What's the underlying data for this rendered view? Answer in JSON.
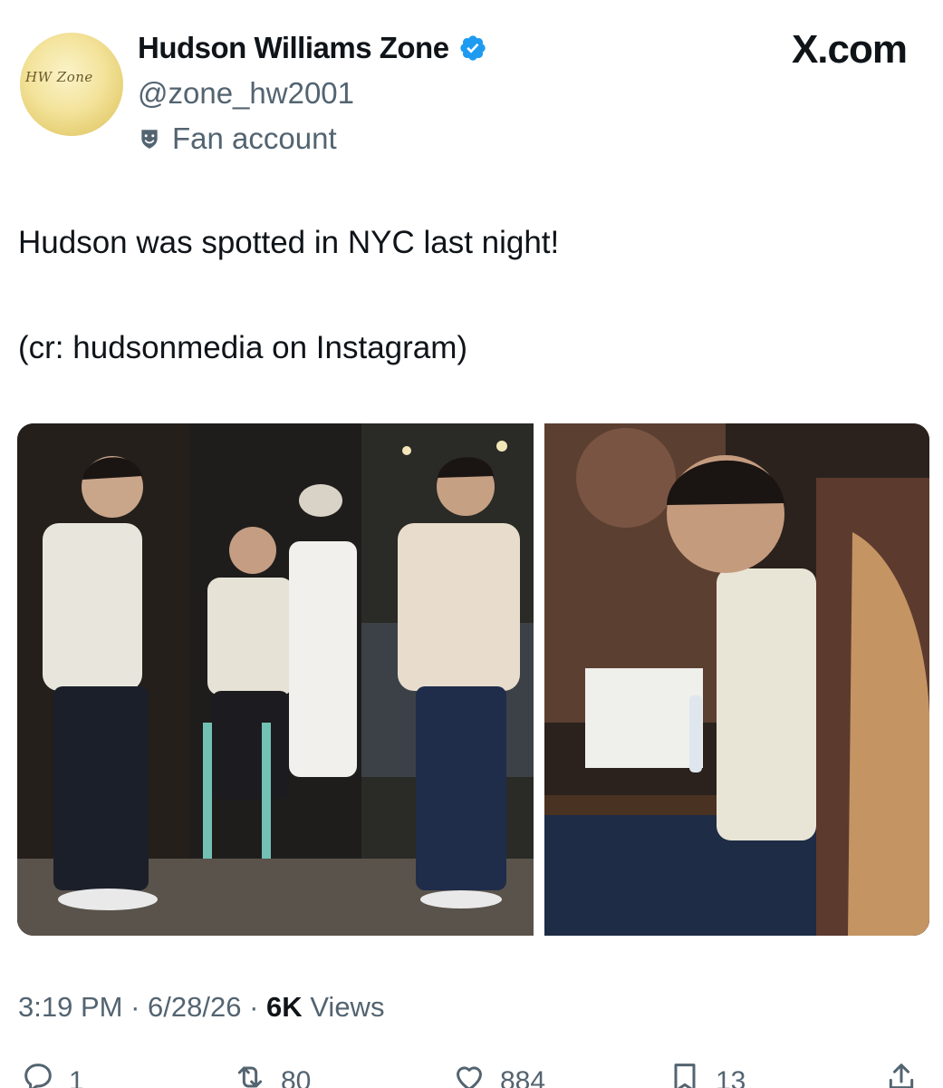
{
  "header": {
    "avatar_text": "HW Zone",
    "display_name": "Hudson Williams Zone",
    "handle": "@zone_hw2001",
    "account_label": "Fan account",
    "site": "X.com"
  },
  "tweet": {
    "line1": "Hudson was spotted in NYC last night!",
    "line2": "(cr: hudsonmedia on Instagram)"
  },
  "meta": {
    "time": "3:19 PM",
    "sep1": "·",
    "date": "6/28/26",
    "sep2": "·",
    "views_count": "6K",
    "views_label": "Views"
  },
  "actions": {
    "replies": "1",
    "reposts": "80",
    "likes": "884",
    "bookmarks": "13"
  },
  "colors": {
    "verified_blue": "#1d9bf0",
    "secondary_text": "#536471",
    "primary_text": "#0f1419"
  },
  "icons": {
    "verified": "verified-badge-icon",
    "label": "fan-account-icon",
    "reply": "reply-icon",
    "repost": "repost-icon",
    "like": "heart-icon",
    "bookmark": "bookmark-icon",
    "share": "share-icon"
  }
}
